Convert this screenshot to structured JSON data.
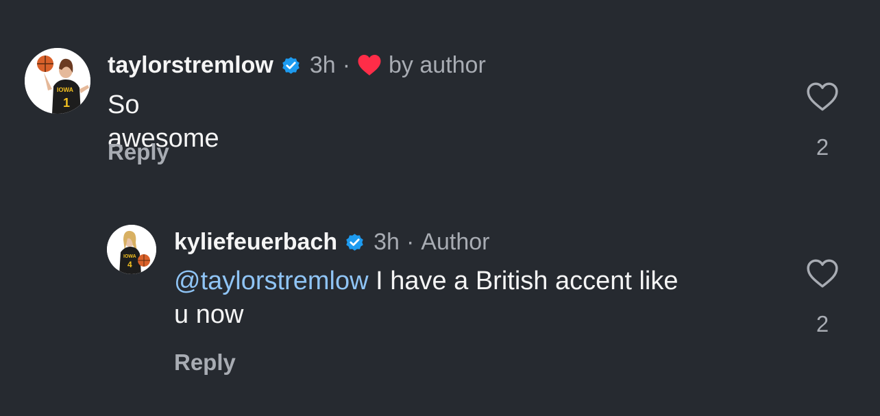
{
  "comments": [
    {
      "username": "taylorstremlow",
      "time": "3h",
      "separator": "·",
      "badge": "by author",
      "text": "So awesome",
      "reply_label": "Reply",
      "like_count": "2"
    },
    {
      "username": "kyliefeuerbach",
      "time": "3h",
      "separator": "·",
      "badge": "Author",
      "mention": "@taylorstremlow",
      "text_line1": " I have a British accent like",
      "text_line2": "u now",
      "reply_label": "Reply",
      "like_count": "2"
    }
  ],
  "colors": {
    "background": "#262a30",
    "verified": "#1d9bf0",
    "heart_liked": "#ff2d48",
    "mention": "#8fc4f5",
    "muted": "#a8acb3"
  },
  "icons": {
    "verified": "verified-badge-icon",
    "liked_by_author": "heart-filled-icon",
    "like": "heart-outline-icon",
    "avatar_1": "avatar-basketball-player-icon",
    "avatar_2": "avatar-basketball-player-icon"
  }
}
